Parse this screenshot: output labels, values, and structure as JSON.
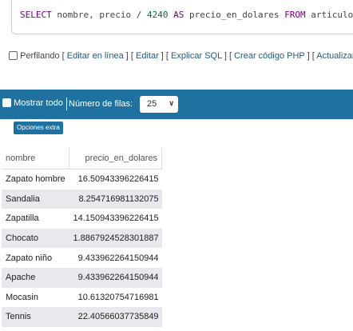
{
  "sql": {
    "select_kw": "SELECT",
    "part1": " nombre, precio / ",
    "number": "4240",
    "as_kw": " AS ",
    "alias": "precio_en_dolares ",
    "from_kw": "FROM",
    "table": " articulos"
  },
  "profiling": {
    "label": "Perfilando",
    "links": [
      "Editar en línea",
      "Editar",
      "Explicar SQL",
      "Crear código PHP",
      "Actualizar"
    ]
  },
  "toolbar": {
    "show_all": "Mostrar todo",
    "rows_label": "Número de filas:",
    "rows_value": "25",
    "extra_options": "Opciones extra"
  },
  "table": {
    "headers": [
      "nombre",
      "precio_en_dolares"
    ],
    "rows": [
      [
        "Zapato hombre",
        "16.50943396226415"
      ],
      [
        "Sandalia",
        "8.254716981132075"
      ],
      [
        "Zapatilla",
        "14.150943396226415"
      ],
      [
        "Chocato",
        "1.8867924528301887"
      ],
      [
        "Zapato niño",
        "9.433962264150944"
      ],
      [
        "Apache",
        "9.433962264150944"
      ],
      [
        "Mocasin",
        "10.61320754716981"
      ],
      [
        "Tennis",
        "22.40566037735849"
      ]
    ]
  }
}
